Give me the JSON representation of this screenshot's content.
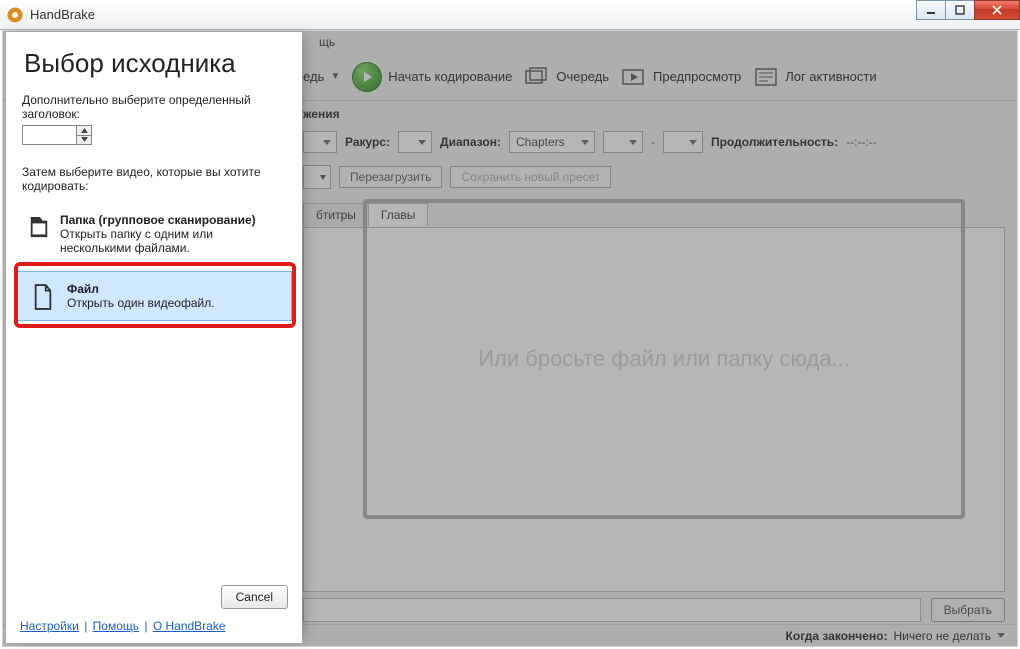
{
  "titlebar": {
    "app_name": "HandBrake"
  },
  "menu": {
    "help_stub": "щь"
  },
  "toolbar": {
    "source_dd_stub": "едь",
    "start": "Начать кодирование",
    "queue": "Очередь",
    "preview": "Предпросмотр",
    "activity": "Лог активности"
  },
  "source_row": {
    "stub": "жения"
  },
  "angle_row": {
    "angle_label": "Ракурс:",
    "range_label": "Диапазон:",
    "range_value": "Chapters",
    "dash": "-",
    "duration_label": "Продолжительность:",
    "duration_value": "--:--:--"
  },
  "preset_row": {
    "reload": "Перезагрузить",
    "save_preset": "Сохранить новый пресет"
  },
  "tabs": {
    "subtitles_stub": "бтитры",
    "chapters": "Главы"
  },
  "dropzone": {
    "text": "Или бросьте файл или папку сюда..."
  },
  "bottom": {
    "browse": "Выбрать"
  },
  "status": {
    "label": "Когда закончено:",
    "value": "Ничего не делать"
  },
  "source_panel": {
    "heading": "Выбор исходника",
    "extra_title_label": "Дополнительно выберите определенный заголовок:",
    "then_select_label": "Затем выберите видео, которые вы хотите кодировать:",
    "folder": {
      "title": "Папка (групповое сканирование)",
      "desc": "Открыть папку с одним или несколькими файлами."
    },
    "file": {
      "title": "Файл",
      "desc": "Открыть один видеофайл."
    },
    "cancel": "Cancel",
    "links": {
      "settings": "Настройки",
      "help": "Помощь",
      "about": "О HandBrake"
    }
  }
}
